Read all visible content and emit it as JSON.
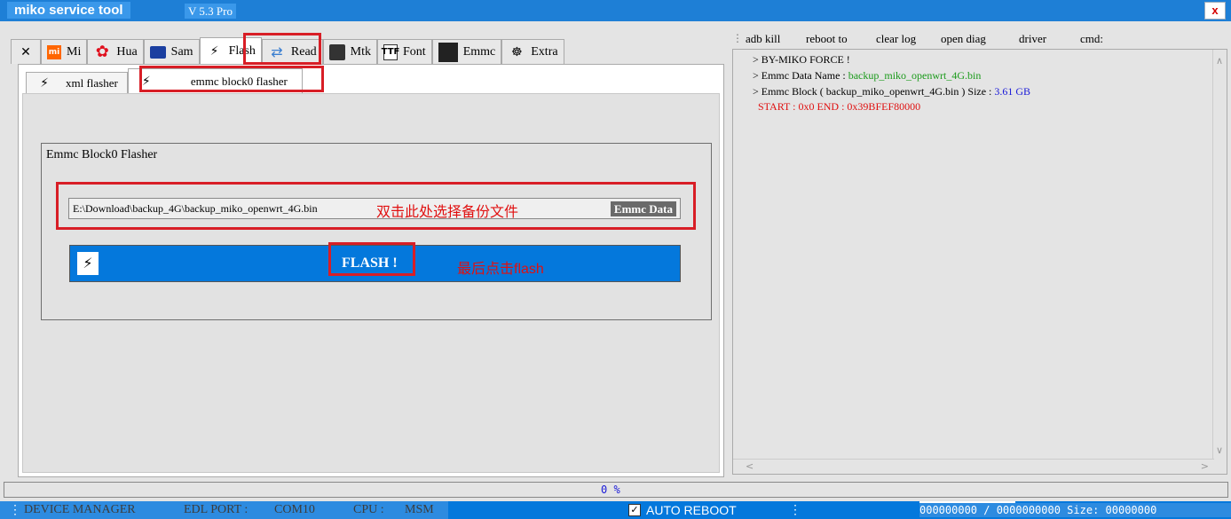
{
  "titlebar": {
    "title": "miko service tool",
    "version": "V 5.3 Pro",
    "close_label": "x"
  },
  "tabs": [
    {
      "label": "",
      "icon": "tools-icon"
    },
    {
      "label": "Mi",
      "icon": "mi-logo-icon"
    },
    {
      "label": "Hua",
      "icon": "huawei-logo-icon"
    },
    {
      "label": "Sam",
      "icon": "samsung-logo-icon"
    },
    {
      "label": "Flash",
      "icon": "lightning-icon"
    },
    {
      "label": "Read",
      "icon": "network-icon"
    },
    {
      "label": "Mtk",
      "icon": "chip-icon"
    },
    {
      "label": "Font",
      "icon": "font-file-icon"
    },
    {
      "label": "Emmc",
      "icon": "emmc-icon"
    },
    {
      "label": "Extra",
      "icon": "extra-icon"
    }
  ],
  "mi_logo_text": "mi",
  "font_icon_text": "TTF",
  "subtabs": [
    {
      "label": "xml flasher"
    },
    {
      "label": "emmc block0 flasher"
    }
  ],
  "group": {
    "title": "Emmc Block0 Flasher",
    "path": "E:\\Download\\backup_4G\\backup_miko_openwrt_4G.bin",
    "hint_path": "双击此处选择备份文件",
    "emmc_data_label": "Emmc Data",
    "flash_label": "FLASH !",
    "hint_flash": "最后点击flash"
  },
  "toolbar": {
    "items": [
      "adb kill",
      "reboot to",
      "clear log",
      "open diag",
      "driver",
      "cmd:"
    ]
  },
  "log": {
    "line1": "> BY-MIKO FORCE !",
    "line2_prefix": "> Emmc Data Name  :",
    "line2_value": "backup_miko_openwrt_4G.bin",
    "line3_prefix": "> Emmc Block ( backup_miko_openwrt_4G.bin ) Size   :",
    "line3_value": "3.61 GB",
    "line4": "START  :  0x0    END :   0x39BFEF80000"
  },
  "progress": {
    "text": "0 %"
  },
  "status": {
    "device_manager": "DEVICE MANAGER",
    "edl_port_label": "EDL PORT :",
    "edl_port_value": "COM10",
    "cpu_label": "CPU :",
    "cpu_value": "MSM",
    "auto_reboot_label": "AUTO REBOOT",
    "auto_reboot_checked": true,
    "size_text": "000000000 / 0000000000 Size: 00000000"
  },
  "colors": {
    "accent": "#0478dc",
    "highlight": "#d81e26",
    "hint_text": "#e01010"
  }
}
